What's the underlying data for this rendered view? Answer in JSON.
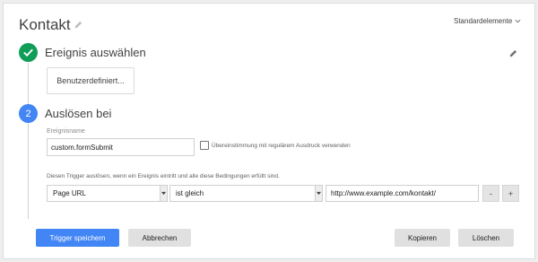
{
  "header": {
    "title": "Kontakt",
    "title_edit_icon": "pencil-icon",
    "standard_elements_label": "Standardelemente",
    "standard_elements_icon": "chevron-down-icon"
  },
  "step1": {
    "status": "done",
    "icon": "checkmark-icon",
    "title": "Ereignis auswählen",
    "edit_icon": "pencil-icon",
    "event_button_label": "Benutzerdefiniert..."
  },
  "step2": {
    "number": "2",
    "title": "Auslösen bei",
    "event_name_label": "Ereignisname",
    "event_name_value": "custom.formSubmit",
    "regex_checked": false,
    "regex_label": "Übereinstimmung mit regulärem Ausdruck verwenden",
    "conditions_text": "Diesen Trigger auslösen, wenn ein Ereignis eintritt und alle diese Bedingungen erfüllt sind.",
    "condition": {
      "variable": "Page URL",
      "operator": "ist gleich",
      "value": "http://www.example.com/kontakt/",
      "remove_label": "-",
      "add_label": "+"
    }
  },
  "footer": {
    "save_label": "Trigger speichern",
    "cancel_label": "Abbrechen",
    "copy_label": "Kopieren",
    "delete_label": "Löschen"
  },
  "colors": {
    "accent": "#4285f4",
    "success": "#0f9d58"
  }
}
